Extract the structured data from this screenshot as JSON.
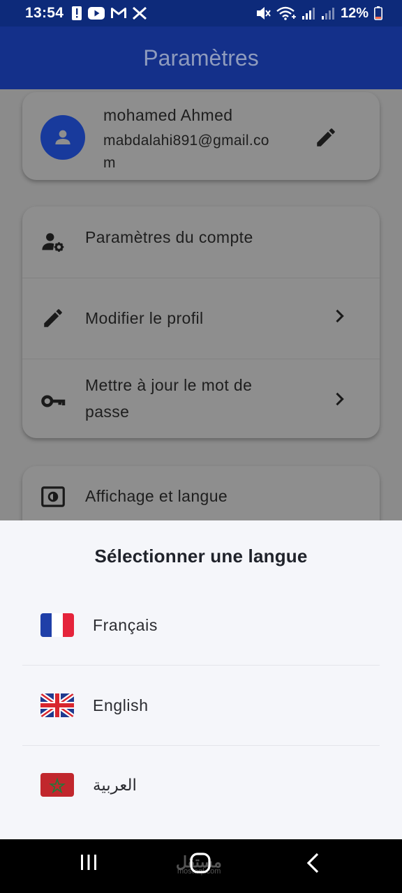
{
  "status_bar": {
    "time": "13:54",
    "battery_percent": "12%",
    "left_icons": [
      "alert-icon",
      "youtube-icon",
      "gmail-icon",
      "x-icon"
    ],
    "right_icons": [
      "mute-icon",
      "wifi-icon",
      "signal-icon",
      "signal-icon",
      "battery-icon"
    ]
  },
  "app_bar": {
    "title": "Paramètres"
  },
  "profile": {
    "name": "mohamed Ahmed",
    "email": "mabdalahi891@gmail.com"
  },
  "account_section": {
    "items": [
      {
        "label": "Paramètres du compte",
        "icon": "account-settings-icon",
        "chevron": false
      },
      {
        "label": "Modifier le profil",
        "icon": "pencil-icon",
        "chevron": true
      },
      {
        "label": "Mettre à jour le mot de passe",
        "icon": "key-icon",
        "chevron": true
      }
    ]
  },
  "display_section": {
    "label": "Affichage et langue",
    "icon": "brightness-icon"
  },
  "language_sheet": {
    "title": "Sélectionner une langue",
    "options": [
      {
        "label": "Français",
        "flag": "france-flag-icon"
      },
      {
        "label": "English",
        "flag": "uk-flag-icon"
      },
      {
        "label": "العربية",
        "flag": "morocco-flag-icon"
      }
    ]
  },
  "watermark": {
    "text": "مستقل",
    "sub": "mostaql.com"
  },
  "colors": {
    "app_bar": "#14308a",
    "status_bar": "#0d2a7a",
    "avatar": "#183a9c",
    "sheet_bg": "#f5f6fa"
  }
}
